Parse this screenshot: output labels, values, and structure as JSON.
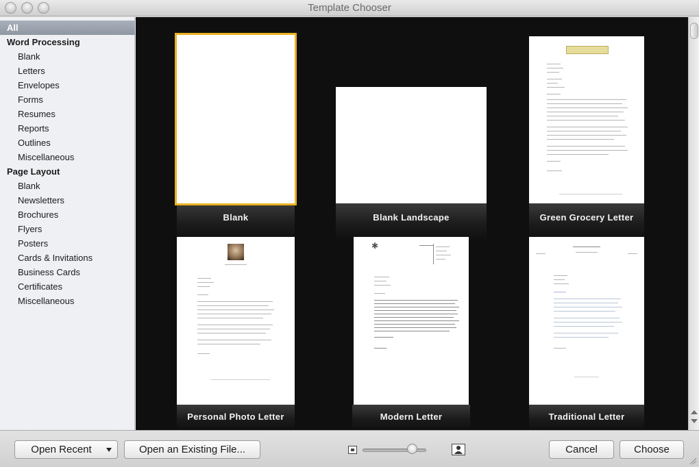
{
  "window": {
    "title": "Template Chooser"
  },
  "sidebar": {
    "items": [
      {
        "label": "All",
        "kind": "selected"
      },
      {
        "label": "Word Processing",
        "kind": "group"
      },
      {
        "label": "Blank",
        "kind": "sub"
      },
      {
        "label": "Letters",
        "kind": "sub"
      },
      {
        "label": "Envelopes",
        "kind": "sub"
      },
      {
        "label": "Forms",
        "kind": "sub"
      },
      {
        "label": "Resumes",
        "kind": "sub"
      },
      {
        "label": "Reports",
        "kind": "sub"
      },
      {
        "label": "Outlines",
        "kind": "sub"
      },
      {
        "label": "Miscellaneous",
        "kind": "sub"
      },
      {
        "label": "Page Layout",
        "kind": "group"
      },
      {
        "label": "Blank",
        "kind": "sub"
      },
      {
        "label": "Newsletters",
        "kind": "sub"
      },
      {
        "label": "Brochures",
        "kind": "sub"
      },
      {
        "label": "Flyers",
        "kind": "sub"
      },
      {
        "label": "Posters",
        "kind": "sub"
      },
      {
        "label": "Cards & Invitations",
        "kind": "sub"
      },
      {
        "label": "Business Cards",
        "kind": "sub"
      },
      {
        "label": "Certificates",
        "kind": "sub"
      },
      {
        "label": "Miscellaneous",
        "kind": "sub"
      }
    ]
  },
  "templates": [
    {
      "label": "Blank",
      "selected": true
    },
    {
      "label": "Blank Landscape",
      "selected": false
    },
    {
      "label": "Green Grocery Letter",
      "selected": false
    },
    {
      "label": "Personal Photo Letter",
      "selected": false
    },
    {
      "label": "Modern Letter",
      "selected": false
    },
    {
      "label": "Traditional Letter",
      "selected": false
    }
  ],
  "bottombar": {
    "open_recent": "Open Recent",
    "open_existing": "Open an Existing File...",
    "cancel": "Cancel",
    "choose": "Choose",
    "zoom_fraction": 0.78
  },
  "colors": {
    "selection_outline": "#e9b221",
    "grid_background": "#0f0f0f"
  }
}
